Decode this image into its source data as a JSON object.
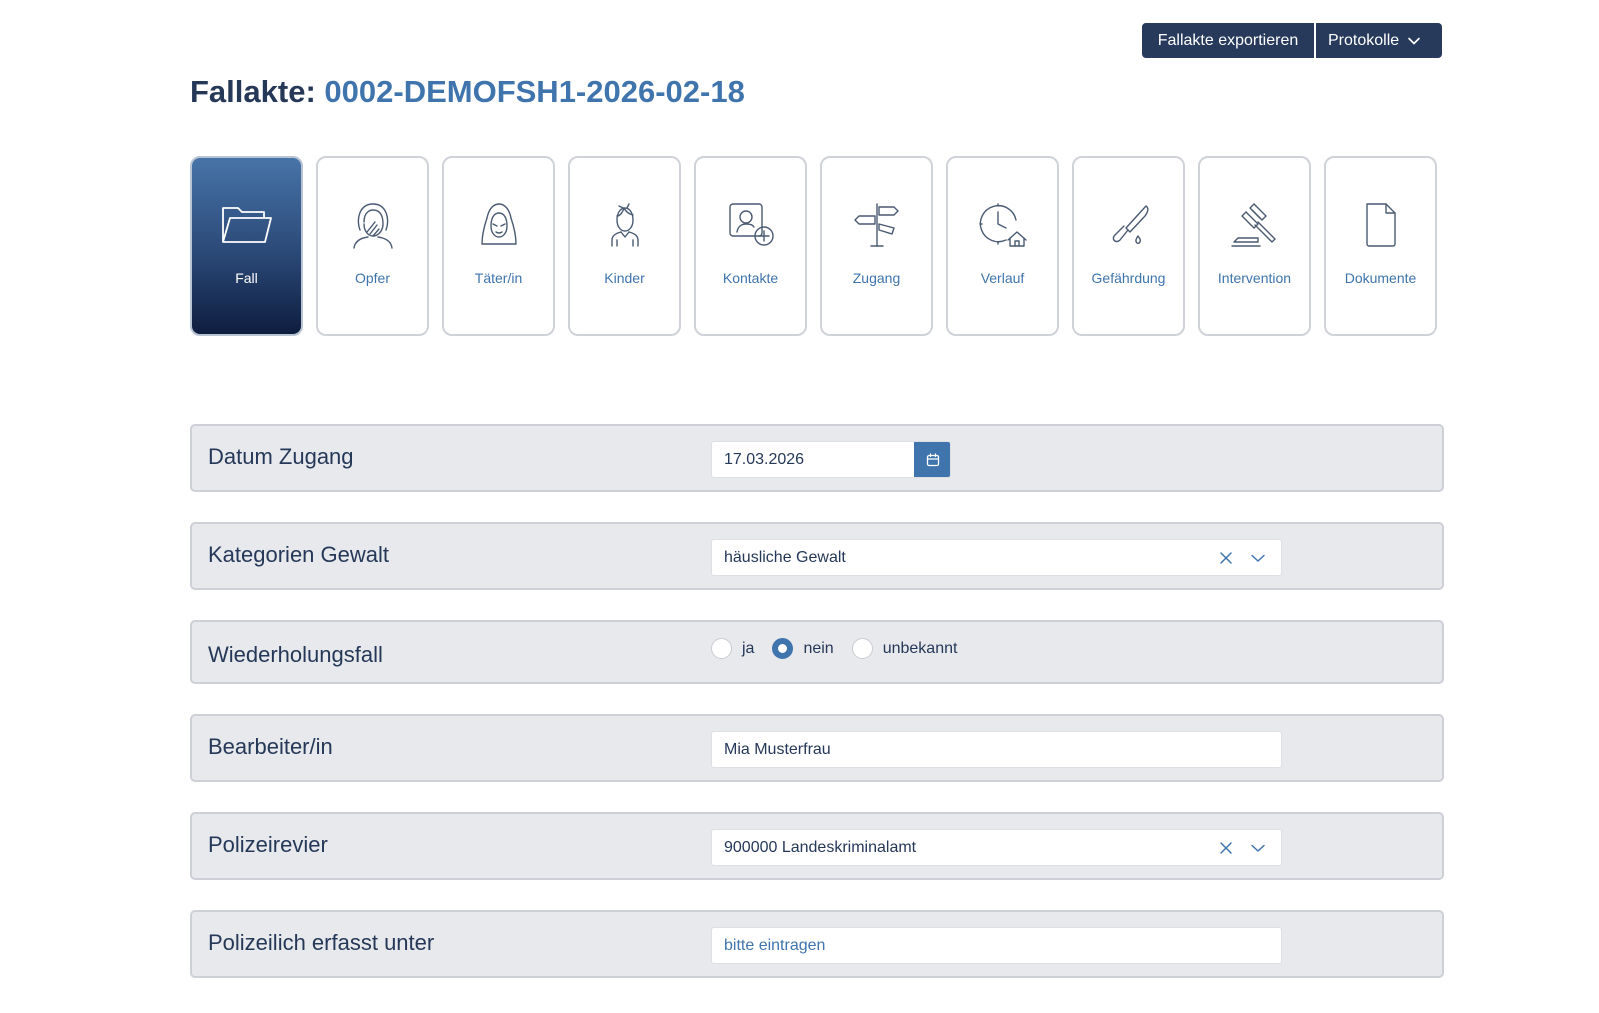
{
  "header": {
    "export_label": "Fallakte exportieren",
    "protocols_label": "Protokolle"
  },
  "title": {
    "prefix": "Fallakte:",
    "case_number": "0002-DEMOFSH1-2026-02-18"
  },
  "tiles": [
    {
      "label": "Fall",
      "icon": "folder-icon",
      "active": true
    },
    {
      "label": "Opfer",
      "icon": "victim-icon",
      "active": false
    },
    {
      "label": "Täter/in",
      "icon": "perpetrator-icon",
      "active": false
    },
    {
      "label": "Kinder",
      "icon": "child-icon",
      "active": false
    },
    {
      "label": "Kontakte",
      "icon": "contact-add-icon",
      "active": false
    },
    {
      "label": "Zugang",
      "icon": "signpost-icon",
      "active": false
    },
    {
      "label": "Verlauf",
      "icon": "clock-house-icon",
      "active": false
    },
    {
      "label": "Gefährdung",
      "icon": "knife-icon",
      "active": false
    },
    {
      "label": "Intervention",
      "icon": "gavel-icon",
      "active": false
    },
    {
      "label": "Dokumente",
      "icon": "document-icon",
      "active": false
    }
  ],
  "form": {
    "datum_zugang": {
      "label": "Datum Zugang",
      "value": "17.03.2026"
    },
    "kategorien_gewalt": {
      "label": "Kategorien Gewalt",
      "value": "häusliche Gewalt"
    },
    "wiederholungsfall": {
      "label": "Wiederholungsfall",
      "options": [
        "ja",
        "nein",
        "unbekannt"
      ],
      "selected": "nein"
    },
    "bearbeiter": {
      "label": "Bearbeiter/in",
      "value": "Mia Musterfrau"
    },
    "polizeirevier": {
      "label": "Polizeirevier",
      "value": "900000 Landeskriminalamt"
    },
    "polizeilich_erfasst": {
      "label": "Polizeilich erfasst unter",
      "value": "",
      "placeholder": "bitte eintragen"
    }
  },
  "colors": {
    "primary_dark": "#273a5c",
    "accent_blue": "#3f74ad",
    "row_background": "#e8e9ed"
  }
}
